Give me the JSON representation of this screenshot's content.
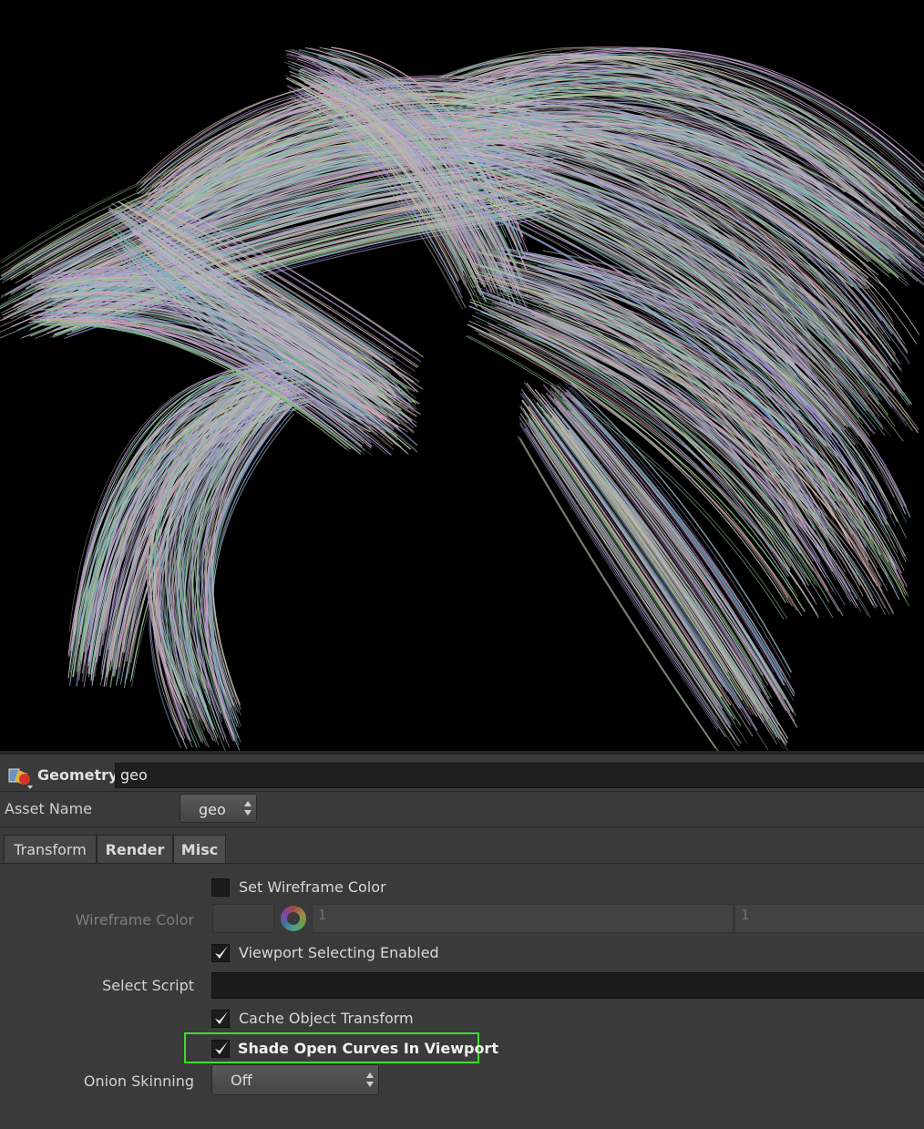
{
  "header": {
    "node_type": "Geometry",
    "node_name": "geo"
  },
  "asset": {
    "label": "Asset Name",
    "value": "geo"
  },
  "tabs": [
    {
      "label": "Transform",
      "active": false
    },
    {
      "label": "Render",
      "active": false
    },
    {
      "label": "Misc",
      "active": true
    }
  ],
  "params": {
    "set_wireframe_color": {
      "label": "Set Wireframe Color",
      "checked": false
    },
    "wireframe_color": {
      "label": "Wireframe Color",
      "values": [
        "1",
        "1"
      ]
    },
    "viewport_selecting": {
      "label": "Viewport Selecting Enabled",
      "checked": true
    },
    "select_script": {
      "label": "Select Script",
      "value": ""
    },
    "cache_object_transform": {
      "label": "Cache Object Transform",
      "checked": true
    },
    "shade_open_curves": {
      "label": "Shade Open Curves In Viewport",
      "checked": true
    },
    "onion_skinning": {
      "label": "Onion Skinning",
      "value": "Off"
    }
  },
  "colors": {
    "highlight": "#3fdc2e",
    "panel_bg": "#3a3a3a",
    "viewport_bg": "#000000"
  }
}
